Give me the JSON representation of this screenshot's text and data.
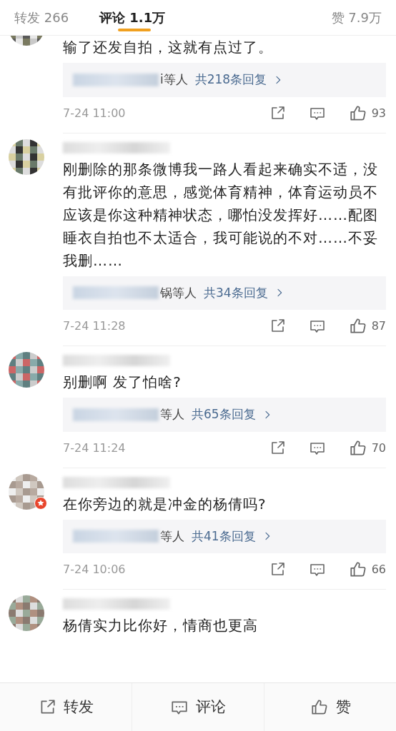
{
  "tabs": [
    {
      "label": "转发 266",
      "selected": false
    },
    {
      "label": "评论 1.1万",
      "selected": true
    },
    {
      "label": "赞 7.9万",
      "selected": false
    }
  ],
  "comments": [
    {
      "username_visible": false,
      "verified": false,
      "text": "输了还发自拍，这就有点过了。",
      "reply": {
        "from": "i等人",
        "count": "共218条回复"
      },
      "time": "7-24 11:00",
      "likes": "93"
    },
    {
      "username_visible": true,
      "verified": false,
      "text": "刚删除的那条微博我一路人看起来确实不适，没有批评你的意思，感觉体育精神，体育运动员不应该是你这种精神状态，哪怕没发挥好……配图睡衣自拍也不太适合，我可能说的不对……不妥我删……",
      "reply": {
        "from": "锅等人",
        "count": "共34条回复"
      },
      "time": "7-24 11:28",
      "likes": "87"
    },
    {
      "username_visible": true,
      "verified": false,
      "text": "别删啊 发了怕啥?",
      "reply": {
        "from": "等人",
        "count": "共65条回复"
      },
      "time": "7-24 11:24",
      "likes": "70"
    },
    {
      "username_visible": true,
      "verified": true,
      "text": "在你旁边的就是冲金的杨倩吗?",
      "reply": {
        "from": "等人",
        "count": "共41条回复"
      },
      "time": "7-24 10:06",
      "likes": "66"
    },
    {
      "username_visible": true,
      "verified": false,
      "text": "杨倩实力比你好，情商也更高"
    }
  ],
  "bottom_bar": [
    {
      "kind": "share",
      "label": "转发"
    },
    {
      "kind": "comment",
      "label": "评论"
    },
    {
      "kind": "like",
      "label": "赞"
    }
  ]
}
